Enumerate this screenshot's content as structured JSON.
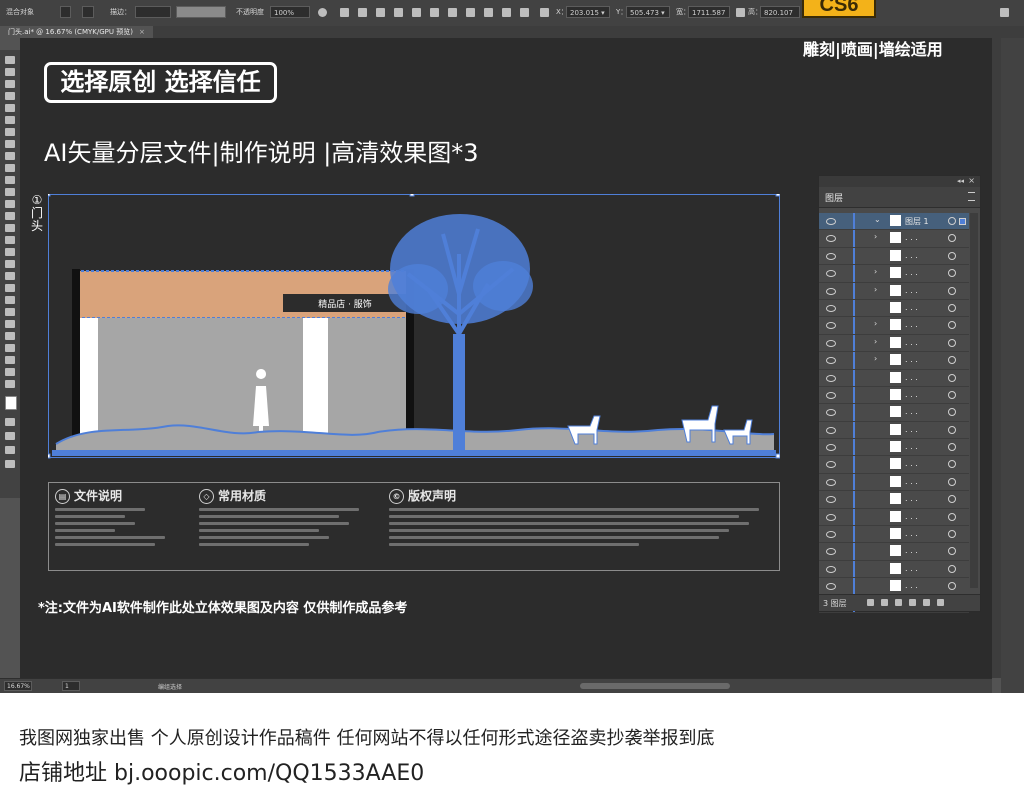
{
  "control_bar": {
    "mode_label": "混合对象",
    "stroke_label": "描边：",
    "opacity_label": "不透明度",
    "opacity_value": "100%",
    "x_label": "X：",
    "x_value": "203.015 ▾",
    "y_label": "Y：",
    "y_value": "505.473 ▾",
    "w_label": "宽：",
    "w_value": "1711.587",
    "h_label": "高：",
    "h_value": "820.107"
  },
  "document_tab": {
    "title": "门头.ai* @ 16.67% (CMYK/GPU 预览)",
    "close": "×"
  },
  "promo": {
    "version_badge": "CS6",
    "tagline": "雕刻|喷画|墙绘适用",
    "badge_text": "选择原创 选择信任",
    "subtitle": "AI矢量分层文件|制作说明 |高清效果图*3",
    "note": "*注:文件为AI软件制作此处立体效果图及内容 仅供制作成品参考"
  },
  "artboard": {
    "vertical_label": "①门头",
    "storefront_sign": "精品店 · 服饰"
  },
  "info_sections": [
    {
      "icon": "doc-icon",
      "title": "文件说明"
    },
    {
      "icon": "gem-icon",
      "title": "常用材质"
    },
    {
      "icon": "copyright-icon",
      "title": "版权声明"
    }
  ],
  "layers_panel": {
    "tab_label": "图层",
    "top_layer_name": "图层 1",
    "sublayer_name": ". . .",
    "layer_count": "3 图层",
    "collapse_label": "◂◂",
    "close_label": "×"
  },
  "status_bar": {
    "zoom": "16.67%",
    "page": "1",
    "tool": "编组选择"
  },
  "footer": {
    "line1": "我图网独家出售 个人原创设计作品稿件 任何网站不得以任何形式途径盗卖抄袭举报到底",
    "line2": "店铺地址 bj.ooopic.com/QQ1533AAE0"
  },
  "colors": {
    "selection_blue": "#4f7fd8",
    "sign_orange": "#d9a37b",
    "accent_gold": "#f3b219",
    "canvas_dark": "#2c2c2c"
  }
}
